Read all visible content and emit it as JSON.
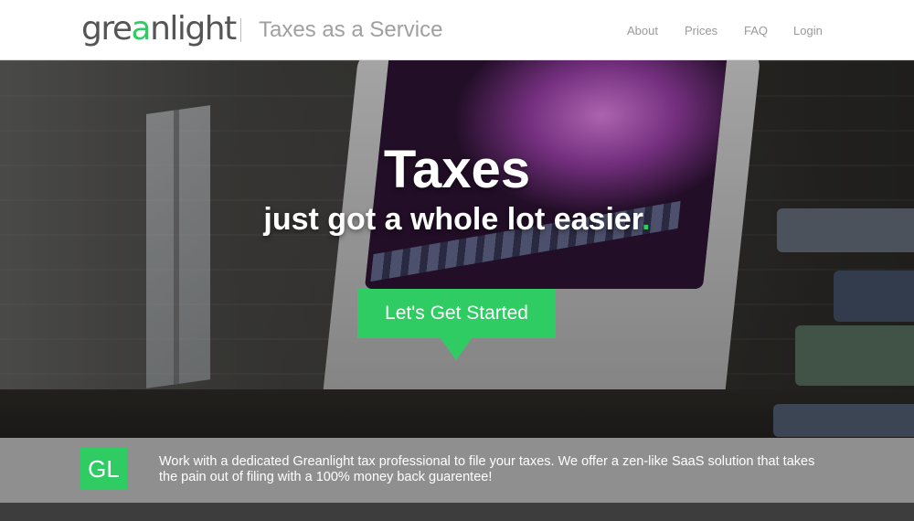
{
  "brand": {
    "logo_pre": "gre",
    "logo_accent": "a",
    "logo_post": "nlight",
    "tagline": "Taxes as a Service",
    "accent_color": "#2ecc63"
  },
  "nav": {
    "items": [
      "About",
      "Prices",
      "FAQ",
      "Login"
    ]
  },
  "hero": {
    "title": "Taxes",
    "subtitle": "just got a whole lot easier",
    "subtitle_dot": ".",
    "cta_label": "Let's Get Started"
  },
  "info": {
    "badge": "GL",
    "text": "Work with a dedicated Greanlight tax professional to file your taxes. We offer a zen-like SaaS solution that takes the pain out of filing with a 100% money back guarentee!"
  }
}
